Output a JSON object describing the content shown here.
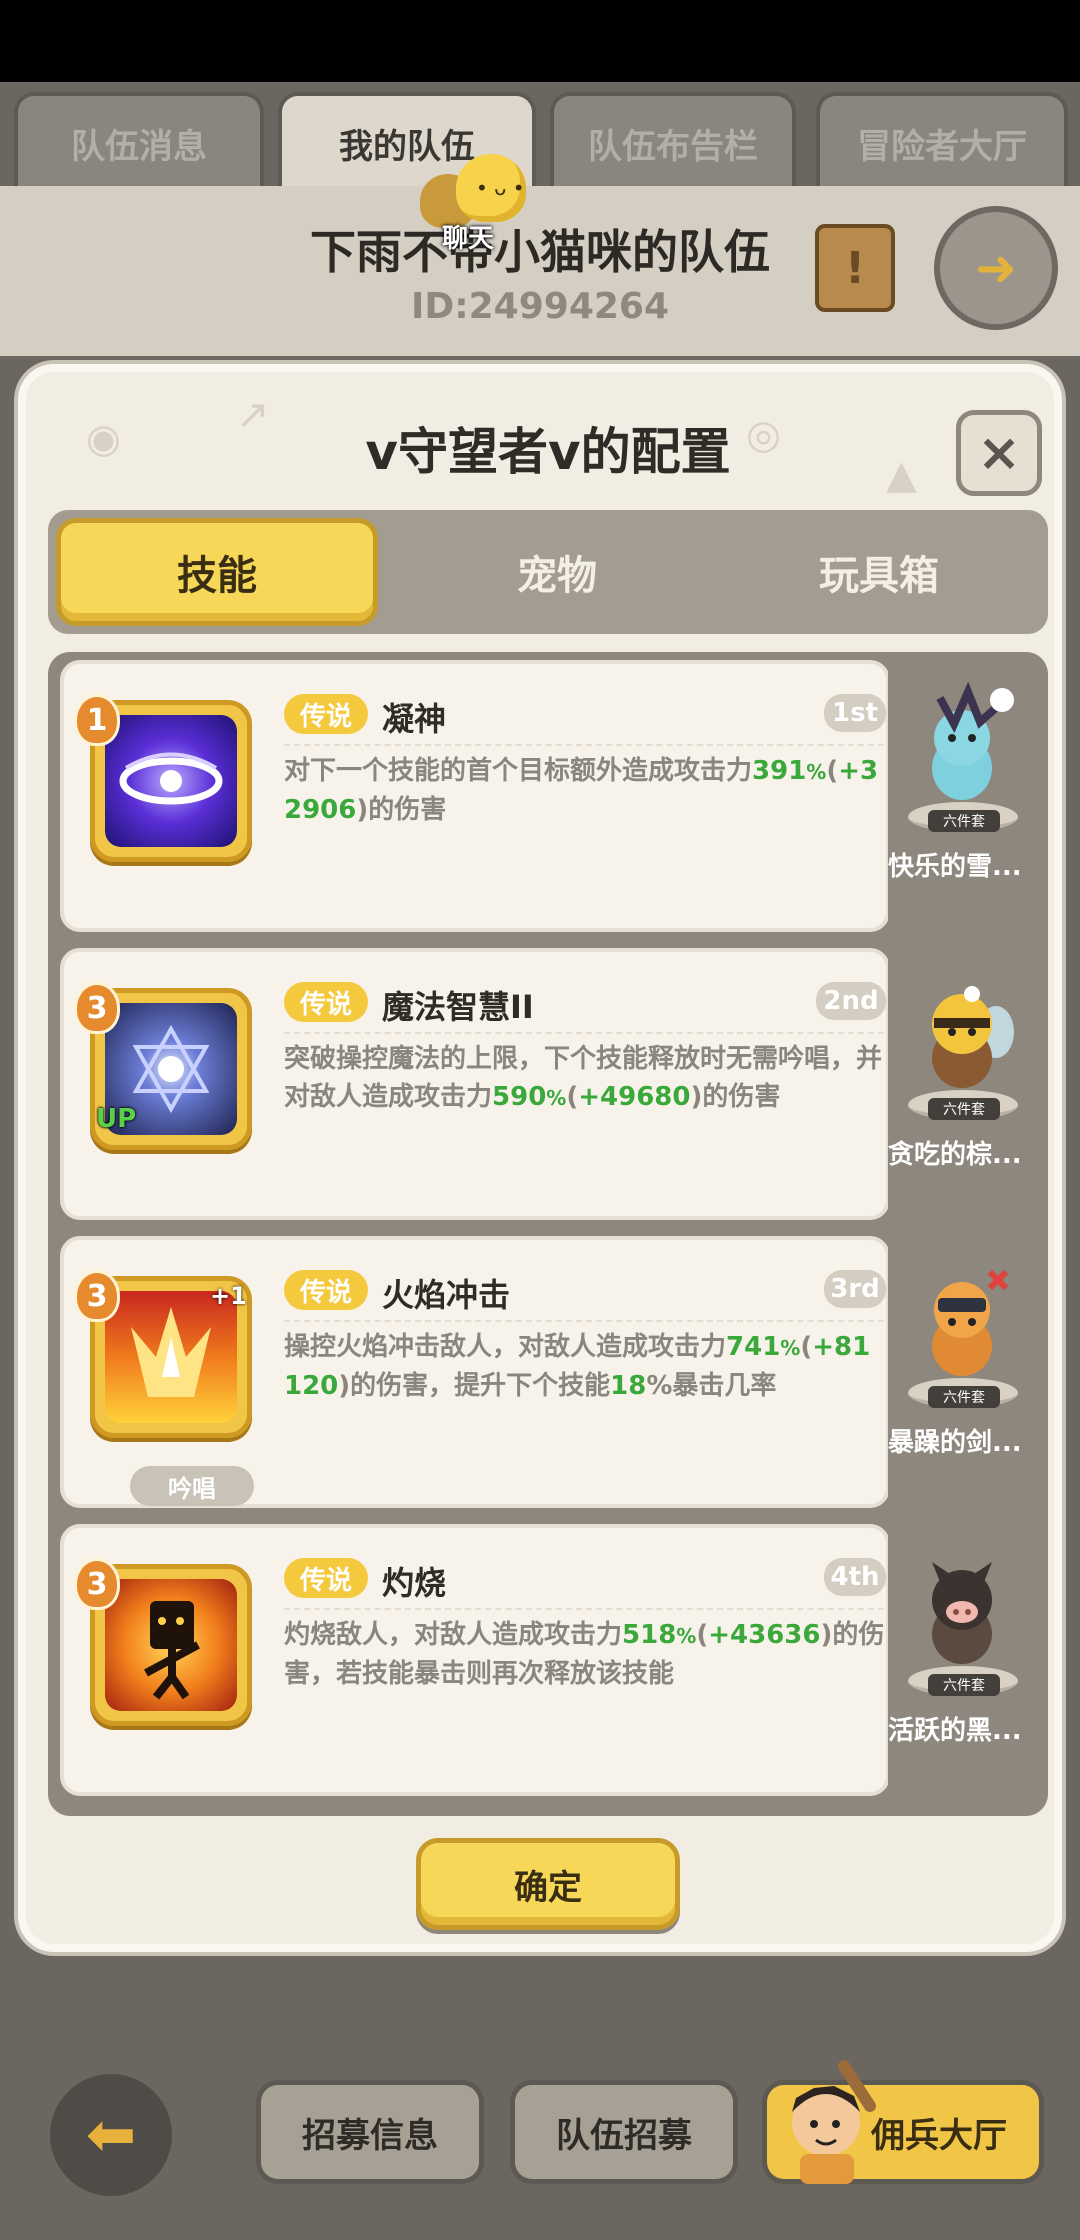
{
  "top_tabs": [
    {
      "label": "队伍消息"
    },
    {
      "label": "我的队伍"
    },
    {
      "label": "队伍布告栏"
    },
    {
      "label": "冒险者大厅"
    }
  ],
  "team": {
    "name": "下雨不带小猫咪的队伍",
    "id": "ID:24994264",
    "chat_label": "聊天"
  },
  "modal": {
    "title": "v守望者v的配置",
    "close_label": "×",
    "sub_tabs": [
      {
        "label": "技能",
        "active": true
      },
      {
        "label": "宠物",
        "active": false
      },
      {
        "label": "玩具箱",
        "active": false
      }
    ],
    "confirm_label": "确定"
  },
  "skills": [
    {
      "level": "1",
      "rarity": "传说",
      "name": "凝神",
      "order": "1st",
      "icon": "vortex-eye-icon",
      "desc": [
        {
          "t": "对下一个技能的首个目标额外造成攻击力"
        },
        {
          "t": "391",
          "c": "g"
        },
        {
          "t": "%",
          "c": "gs"
        },
        {
          "t": "("
        },
        {
          "t": "+32906",
          "c": "g"
        },
        {
          "t": ")的伤害"
        }
      ]
    },
    {
      "level": "3",
      "rarity": "传说",
      "name": "魔法智慧II",
      "order": "2nd",
      "icon": "hexagram-orb-icon",
      "up": "UP",
      "desc": [
        {
          "t": "突破操控魔法的上限，下个技能释放时无需吟唱，并对敌人造成攻击力"
        },
        {
          "t": "590",
          "c": "g"
        },
        {
          "t": "%",
          "c": "gs"
        },
        {
          "t": "("
        },
        {
          "t": "+49680",
          "c": "g"
        },
        {
          "t": ")的伤害"
        }
      ]
    },
    {
      "level": "3",
      "rarity": "传说",
      "name": "火焰冲击",
      "order": "3rd",
      "icon": "flame-burst-icon",
      "plus": "+1",
      "chant": "吟唱",
      "desc": [
        {
          "t": "操控火焰冲击敌人，对敌人造成攻击力"
        },
        {
          "t": "741",
          "c": "g"
        },
        {
          "t": "%",
          "c": "gs"
        },
        {
          "t": "("
        },
        {
          "t": "+81120",
          "c": "g"
        },
        {
          "t": ")的伤害，提升下个技能"
        },
        {
          "t": "18",
          "c": "g"
        },
        {
          "t": "%暴击几率"
        }
      ]
    },
    {
      "level": "3",
      "rarity": "传说",
      "name": "灼烧",
      "order": "4th",
      "icon": "burning-figure-icon",
      "desc": [
        {
          "t": "灼烧敌人，对敌人造成攻击力"
        },
        {
          "t": "518",
          "c": "g"
        },
        {
          "t": "%",
          "c": "gs"
        },
        {
          "t": "("
        },
        {
          "t": "+43636",
          "c": "g"
        },
        {
          "t": ")的伤害，若技能暴击则再次释放该技能"
        }
      ]
    }
  ],
  "pets": [
    {
      "name": "快乐的雪...",
      "set": "六件套",
      "icon": "snow-bunny-pet-icon"
    },
    {
      "name": "贪吃的棕...",
      "set": "六件套",
      "icon": "bee-bear-pet-icon"
    },
    {
      "name": "暴躁的剑...",
      "set": "六件套",
      "icon": "armored-cat-pet-icon"
    },
    {
      "name": "活跃的黑...",
      "set": "六件套",
      "icon": "boar-pet-icon"
    }
  ],
  "bottom": {
    "recruit_info": "招募信息",
    "team_recruit": "队伍招募",
    "mercenary_hall": "佣兵大厅"
  },
  "colors": {
    "accent_yellow": "#f6d757",
    "highlight_green": "#3aa83a",
    "panel_bg": "#f2ede3"
  }
}
